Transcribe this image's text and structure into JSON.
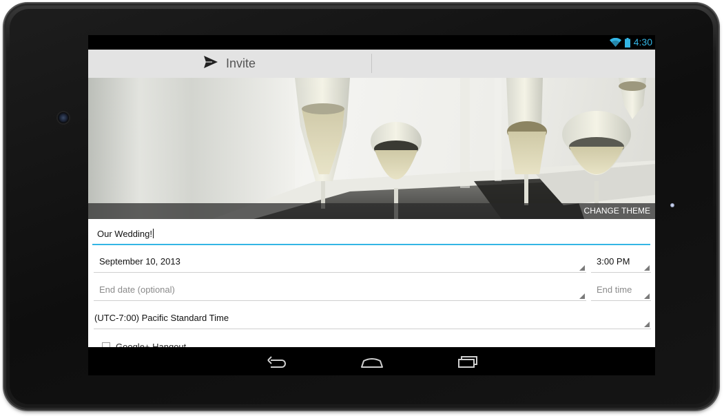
{
  "status_bar": {
    "time": "4:30",
    "wifi_icon": "wifi-icon",
    "battery_icon": "battery-icon"
  },
  "action_bar": {
    "invite_label": "Invite",
    "invite_icon": "send-arrow-icon"
  },
  "banner": {
    "image": "champagne-glasses-photo",
    "change_theme_label": "CHANGE THEME"
  },
  "form": {
    "title_value": "Our Wedding!",
    "start_date": "September 10, 2013",
    "start_time": "3:00 PM",
    "end_date_placeholder": "End date (optional)",
    "end_time_placeholder": "End time",
    "timezone": "(UTC-7:00) Pacific Standard Time",
    "hangout_label": "Google+ Hangout",
    "hangout_checked": false
  },
  "nav_bar": {
    "buttons": [
      "back-icon",
      "home-icon",
      "recent-apps-icon"
    ]
  },
  "colors": {
    "accent": "#33b5e5",
    "action_bar_bg": "#e3e3e3",
    "status_bar_bg": "#000000"
  }
}
